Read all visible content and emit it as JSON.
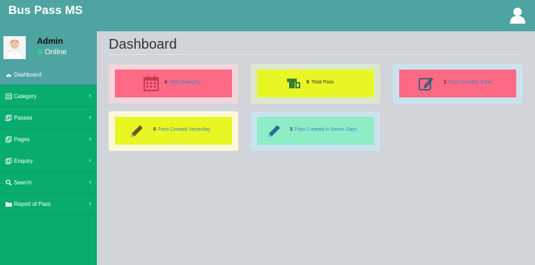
{
  "app": {
    "title": "Bus Pass MS"
  },
  "user": {
    "name": "Admin",
    "status": "Online"
  },
  "sidebar": {
    "items": [
      {
        "label": "Dashboard",
        "icon": "dashboard-icon",
        "active": true,
        "chevron": ""
      },
      {
        "label": "Category",
        "icon": "list-icon",
        "active": false,
        "chevron": "‹"
      },
      {
        "label": "Passes",
        "icon": "copy-icon",
        "active": false,
        "chevron": "‹"
      },
      {
        "label": "Pages",
        "icon": "copy-icon",
        "active": false,
        "chevron": "‹"
      },
      {
        "label": "Enquiry",
        "icon": "copy-icon",
        "active": false,
        "chevron": "‹"
      },
      {
        "label": "Search",
        "icon": "search-icon",
        "active": false,
        "chevron": "‹"
      },
      {
        "label": "Report of Pass",
        "icon": "folder-icon",
        "active": false,
        "chevron": "‹"
      }
    ]
  },
  "main": {
    "title": "Dashboard"
  },
  "cards": [
    {
      "count": "4",
      "label": "Total Category",
      "icon": "calendar-icon",
      "outer": "#f1d6dc",
      "inner": "#fe6986",
      "iconColor": "#c23c4e"
    },
    {
      "count": "6",
      "label": "Total Pass",
      "icon": "ticket-icon",
      "outer": "#dbe8cf",
      "inner": "#e8f623",
      "iconColor": "#3a7d3a"
    },
    {
      "count": "1",
      "label": "Pass Created Today",
      "icon": "edit-icon",
      "outer": "#cde2ef",
      "inner": "#fe6986",
      "iconColor": "#3a6279"
    },
    {
      "count": "0",
      "label": "Pass Created Yesterday",
      "icon": "pencil-icon",
      "outer": "#fdf8dc",
      "inner": "#e8f623",
      "iconColor": "#6f5a2a"
    },
    {
      "count": "3",
      "label": "Pass Created in Seven Days",
      "icon": "pencil-icon",
      "outer": "#cde2ef",
      "inner": "#8eedc6",
      "iconColor": "#2c6d90"
    }
  ],
  "colors": {
    "header": "#4ea4a0",
    "sidebar": "#08ad6d",
    "background": "#d1d4d9"
  }
}
